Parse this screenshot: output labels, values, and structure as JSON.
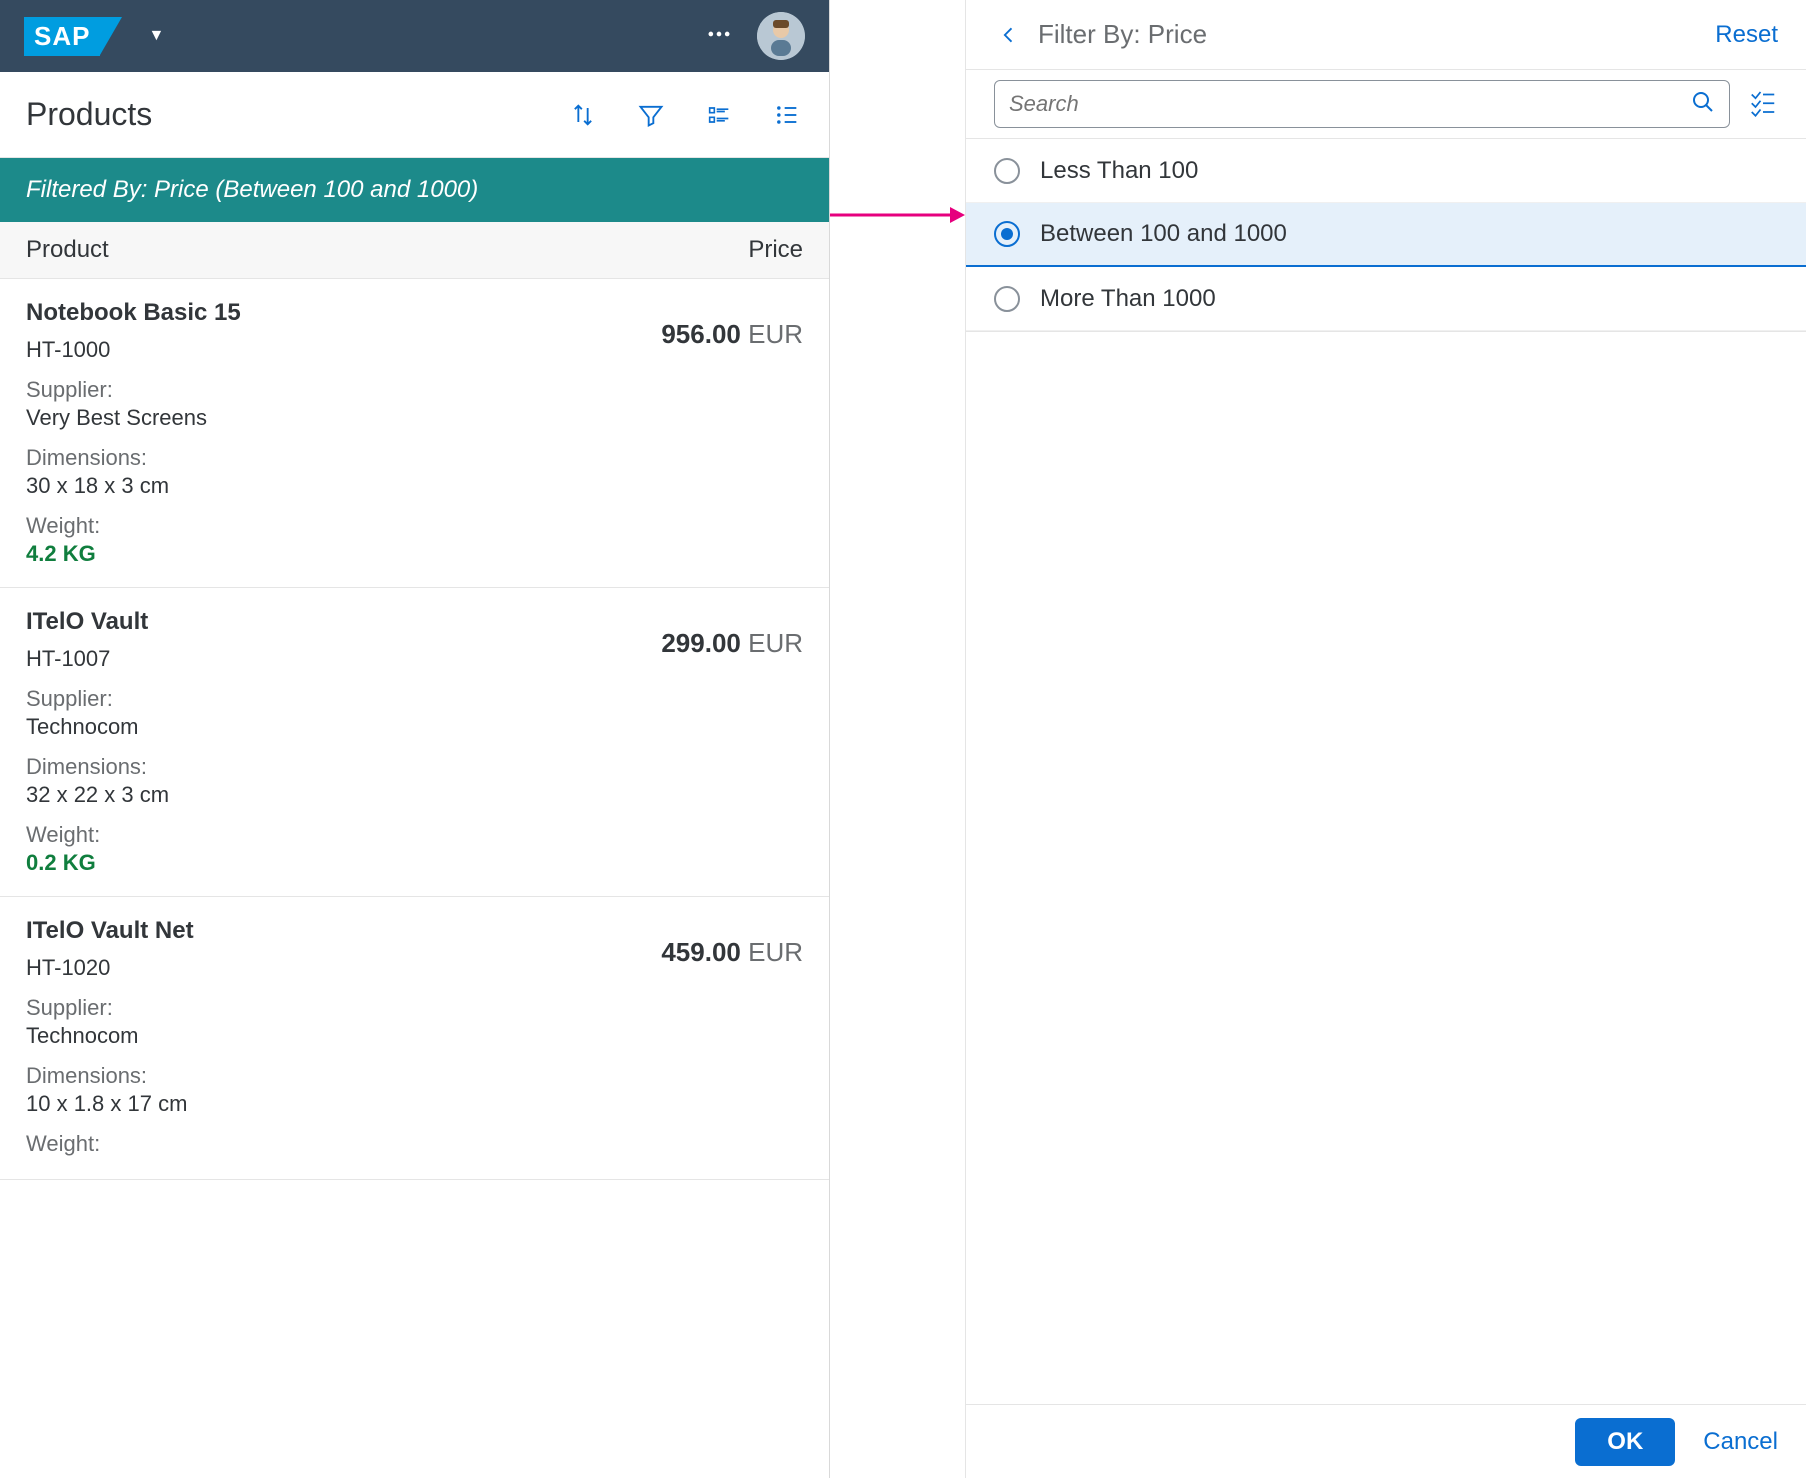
{
  "shell": {
    "logo_text": "SAP"
  },
  "page": {
    "title": "Products",
    "filter_info": "Filtered By: Price (Between 100 and 1000)"
  },
  "list_headers": {
    "product": "Product",
    "price": "Price"
  },
  "labels": {
    "supplier": "Supplier:",
    "dimensions": "Dimensions:",
    "weight": "Weight:"
  },
  "products": [
    {
      "name": "Notebook Basic 15",
      "sku": "HT-1000",
      "price": "956.00",
      "currency": "EUR",
      "supplier": "Very Best Screens",
      "dimensions": "30 x 18 x 3 cm",
      "weight": "4.2 KG"
    },
    {
      "name": "ITelO Vault",
      "sku": "HT-1007",
      "price": "299.00",
      "currency": "EUR",
      "supplier": "Technocom",
      "dimensions": "32 x 22 x 3 cm",
      "weight": "0.2 KG"
    },
    {
      "name": "ITelO Vault Net",
      "sku": "HT-1020",
      "price": "459.00",
      "currency": "EUR",
      "supplier": "Technocom",
      "dimensions": "10 x 1.8 x 17 cm",
      "weight": ""
    }
  ],
  "filter_panel": {
    "title": "Filter By: Price",
    "reset": "Reset",
    "search_placeholder": "Search",
    "options": [
      {
        "label": "Less Than 100",
        "selected": false
      },
      {
        "label": "Between 100 and 1000",
        "selected": true
      },
      {
        "label": "More Than 1000",
        "selected": false
      }
    ],
    "ok": "OK",
    "cancel": "Cancel"
  }
}
